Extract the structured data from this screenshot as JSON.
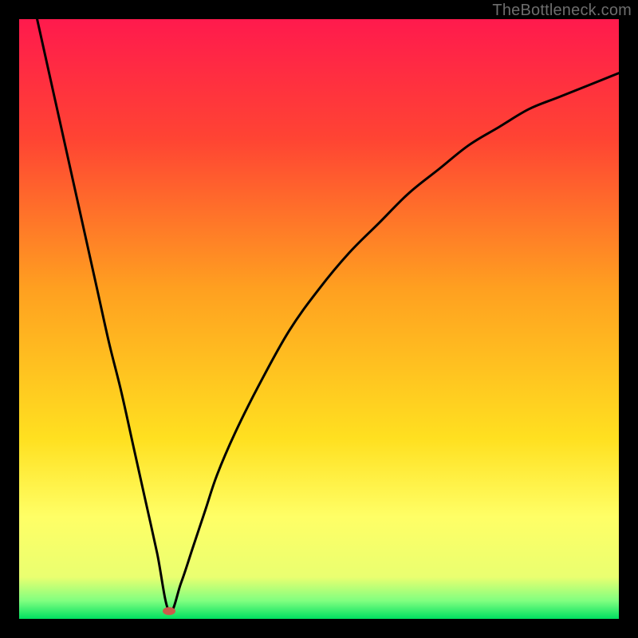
{
  "watermark": "TheBottleneck.com",
  "chart_data": {
    "type": "line",
    "title": "",
    "xlabel": "",
    "ylabel": "",
    "xlim": [
      0,
      100
    ],
    "ylim": [
      0,
      100
    ],
    "background_gradient": {
      "stops": [
        {
          "offset": 0.0,
          "color": "#ff1a4d"
        },
        {
          "offset": 0.2,
          "color": "#ff4433"
        },
        {
          "offset": 0.45,
          "color": "#ffa020"
        },
        {
          "offset": 0.7,
          "color": "#ffe020"
        },
        {
          "offset": 0.83,
          "color": "#ffff66"
        },
        {
          "offset": 0.93,
          "color": "#eaff70"
        },
        {
          "offset": 0.97,
          "color": "#80ff80"
        },
        {
          "offset": 1.0,
          "color": "#00e060"
        }
      ]
    },
    "minimum_marker": {
      "x": 25,
      "y": 1.3,
      "color": "#cc5a4a"
    },
    "series": [
      {
        "name": "curve",
        "x": [
          3,
          5,
          7,
          9,
          11,
          13,
          15,
          17,
          19,
          21,
          23,
          25,
          27,
          29,
          31,
          33,
          36,
          40,
          45,
          50,
          55,
          60,
          65,
          70,
          75,
          80,
          85,
          90,
          95,
          100
        ],
        "y": [
          100,
          91,
          82,
          73,
          64,
          55,
          46,
          38,
          29,
          20,
          11,
          1.3,
          6,
          12,
          18,
          24,
          31,
          39,
          48,
          55,
          61,
          66,
          71,
          75,
          79,
          82,
          85,
          87,
          89,
          91
        ]
      }
    ]
  }
}
